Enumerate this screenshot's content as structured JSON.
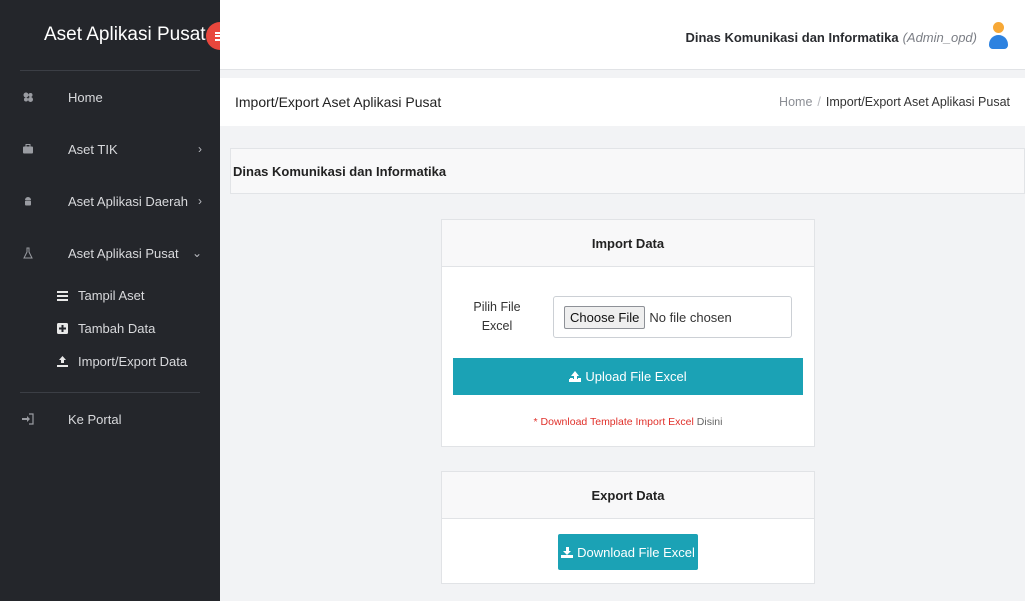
{
  "sidebar": {
    "brand": "Aset Aplikasi Pusat",
    "items": [
      {
        "label": "Home",
        "icon": "dashboard-icon"
      },
      {
        "label": "Aset TIK",
        "icon": "briefcase-icon",
        "chevron": "›"
      },
      {
        "label": "Aset Aplikasi Daerah",
        "icon": "android-icon",
        "chevron": "›"
      },
      {
        "label": "Aset Aplikasi Pusat",
        "icon": "flask-icon",
        "chevron": "⌄"
      }
    ],
    "sub_items": [
      {
        "label": "Tampil Aset",
        "icon": "list-icon"
      },
      {
        "label": "Tambah Data",
        "icon": "plus-square-icon"
      },
      {
        "label": "Import/Export Data",
        "icon": "upload-icon"
      }
    ],
    "portal": {
      "label": "Ke Portal",
      "icon": "sign-in-icon"
    }
  },
  "topbar": {
    "org": "Dinas Komunikasi dan Informatika",
    "role": "(Admin_opd)"
  },
  "header": {
    "title": "Import/Export Aset Aplikasi Pusat",
    "breadcrumb_home": "Home",
    "breadcrumb_sep": "/",
    "breadcrumb_current": "Import/Export Aset Aplikasi Pusat"
  },
  "org_bar": "Dinas Komunikasi dan Informatika",
  "import": {
    "title": "Import Data",
    "file_label_line1": "Pilih File",
    "file_label_line2": "Excel",
    "choose_file": "Choose File",
    "no_file": "No file chosen",
    "upload_label": "Upload File Excel",
    "note_red": "* Download Template Import Excel",
    "note_link": "Disini"
  },
  "export": {
    "title": "Export Data",
    "download_label": "Download File Excel"
  },
  "colors": {
    "sidebar_bg": "#24262b",
    "accent_teal": "#1ba2b5",
    "toggle_red": "#e8473d"
  }
}
